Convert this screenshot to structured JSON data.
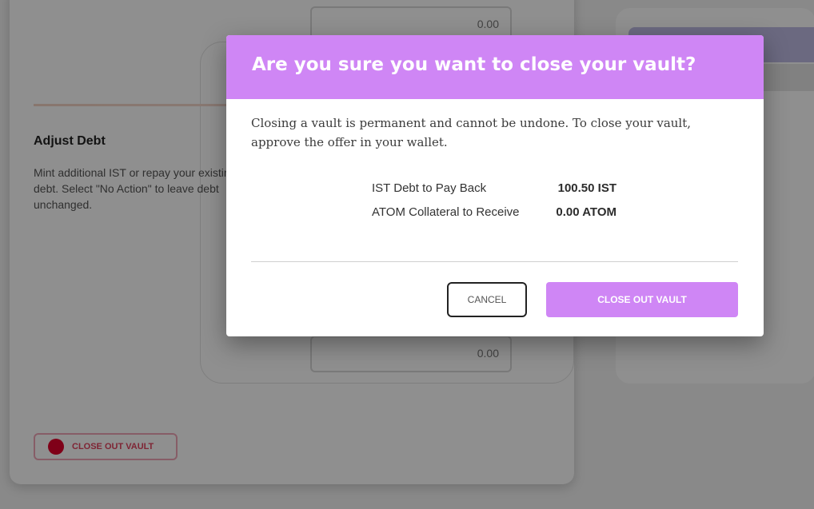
{
  "background": {
    "input_top_value": "0.00",
    "input_bottom_value": "0.00",
    "adjust_heading": "Adjust Debt",
    "adjust_description": "Mint additional IST or repay your existing IST debt. Select \"No Action\" to leave debt unchanged.",
    "close_vault_button": "Close Out Vault"
  },
  "modal": {
    "title": "Are you sure you want to close your vault?",
    "description": "Closing a vault is permanent and cannot be undone. To close your vault, approve the offer in your wallet.",
    "summary": [
      {
        "label": "IST Debt to Pay Back",
        "value": "100.50 IST"
      },
      {
        "label": "ATOM Collateral to Receive",
        "value": "0.00 ATOM"
      }
    ],
    "cancel_label": "Cancel",
    "confirm_label": "Close Out Vault"
  },
  "colors": {
    "accent": "#cf86f5",
    "danger": "#e3002b"
  }
}
